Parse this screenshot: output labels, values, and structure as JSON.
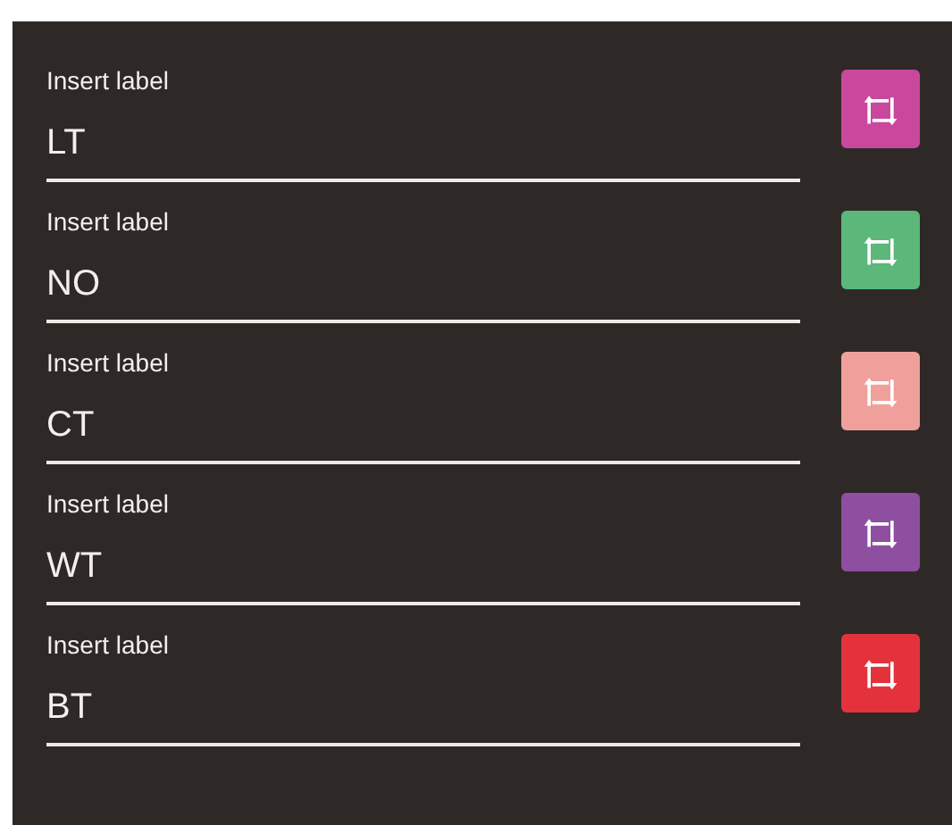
{
  "fields": [
    {
      "label": "Insert label",
      "value": "LT",
      "color": "#c9489e"
    },
    {
      "label": "Insert label",
      "value": "NO",
      "color": "#5bb77a"
    },
    {
      "label": "Insert label",
      "value": "CT",
      "color": "#f0a09a"
    },
    {
      "label": "Insert label",
      "value": "WT",
      "color": "#8e4fa1"
    },
    {
      "label": "Insert label",
      "value": "BT",
      "color": "#e4323c"
    }
  ]
}
